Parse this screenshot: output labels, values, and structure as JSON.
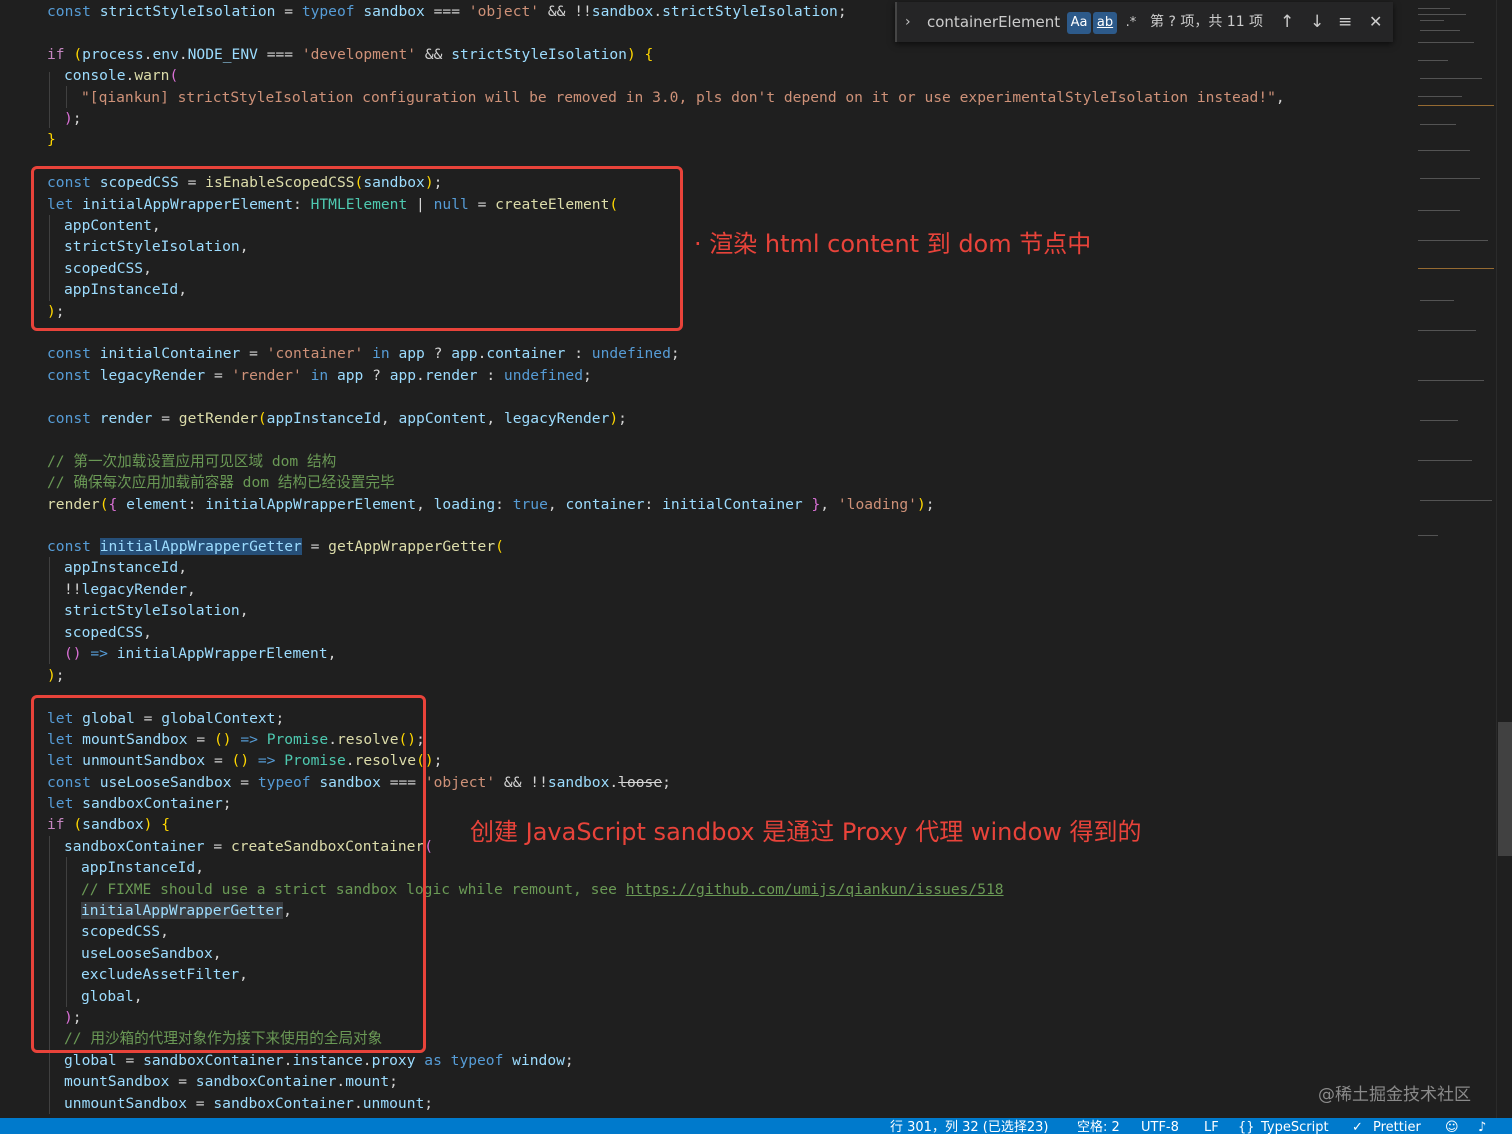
{
  "find_widget": {
    "query": "containerElement",
    "match_case_label": "Aa",
    "whole_word_label": "ab",
    "regex_label": ".*",
    "result_text": "第 ? 项，共 11 项"
  },
  "code": {
    "l1": {
      "a": "const ",
      "b": "strictStyleIsolation",
      "c": " = ",
      "d": "typeof ",
      "e": "sandbox",
      "f": " === ",
      "g": "'object'",
      "h": " && !!",
      "i": "sandbox",
      "j": ".",
      "k": "strictStyleIsolation",
      "l": ";"
    },
    "l3": {
      "a": "if ",
      "b": "(",
      "c": "process",
      "d": ".",
      "e": "env",
      "f": ".",
      "g": "NODE_ENV",
      "h": " === ",
      "i": "'development'",
      "j": " && ",
      "k": "strictStyleIsolation",
      "l": ") {"
    },
    "l4": {
      "a": "console",
      "b": ".",
      "c": "warn",
      "d": "("
    },
    "l5": {
      "a": "\"[qiankun] strictStyleIsolation configuration will be removed in 3.0, pls don't depend on it or use experimentalStyleIsolation instead!\"",
      "b": ","
    },
    "l6": {
      "a": ")",
      "b": ";"
    },
    "l7": {
      "a": "}"
    },
    "l9": {
      "a": "const ",
      "b": "scopedCSS",
      "c": " = ",
      "d": "isEnableScopedCSS",
      "e": "(",
      "f": "sandbox",
      "g": ")",
      "h": ";"
    },
    "l10": {
      "a": "let ",
      "b": "initialAppWrapperElement",
      "c": ": ",
      "d": "HTMLElement",
      "e": " | ",
      "f": "null",
      "g": " = ",
      "h": "createElement",
      "i": "("
    },
    "l11": {
      "a": "appContent",
      "b": ","
    },
    "l12": {
      "a": "strictStyleIsolation",
      "b": ","
    },
    "l13": {
      "a": "scopedCSS",
      "b": ","
    },
    "l14": {
      "a": "appInstanceId",
      "b": ","
    },
    "l15": {
      "a": ")",
      "b": ";"
    },
    "l17": {
      "a": "const ",
      "b": "initialContainer",
      "c": " = ",
      "d": "'container'",
      "e": " in ",
      "f": "app",
      "g": " ? ",
      "h": "app",
      "i": ".",
      "j": "container",
      "k": " : ",
      "l": "undefined",
      "m": ";"
    },
    "l18": {
      "a": "const ",
      "b": "legacyRender",
      "c": " = ",
      "d": "'render'",
      "e": " in ",
      "f": "app",
      "g": " ? ",
      "h": "app",
      "i": ".",
      "j": "render",
      "k": " : ",
      "l": "undefined",
      "m": ";"
    },
    "l20": {
      "a": "const ",
      "b": "render",
      "c": " = ",
      "d": "getRender",
      "e": "(",
      "f": "appInstanceId",
      "g": ", ",
      "h": "appContent",
      "i": ", ",
      "j": "legacyRender",
      "k": ")",
      "l": ";"
    },
    "l22": {
      "a": "// 第一次加载设置应用可见区域 dom 结构"
    },
    "l23": {
      "a": "// 确保每次应用加载前容器 dom 结构已经设置完毕"
    },
    "l24": {
      "a": "render",
      "b": "(",
      "c": "{ ",
      "d": "element",
      "e": ": ",
      "f": "initialAppWrapperElement",
      "g": ", ",
      "h": "loading",
      "i": ": ",
      "j": "true",
      "k": ", ",
      "l": "container",
      "m": ": ",
      "n": "initialContainer",
      "o": " }",
      "p": ", ",
      "q": "'loading'",
      "r": ")",
      "s": ";"
    },
    "l26": {
      "a": "const ",
      "b": "initialAppWrapperGetter",
      "c": " = ",
      "d": "getAppWrapperGetter",
      "e": "("
    },
    "l27": {
      "a": "appInstanceId",
      "b": ","
    },
    "l28": {
      "a": "!!",
      "b": "legacyRender",
      "c": ","
    },
    "l29": {
      "a": "strictStyleIsolation",
      "b": ","
    },
    "l30": {
      "a": "scopedCSS",
      "b": ","
    },
    "l31": {
      "a": "()",
      "b": " => ",
      "c": "initialAppWrapperElement",
      "d": ","
    },
    "l32": {
      "a": ")",
      "b": ";"
    },
    "l34": {
      "a": "let ",
      "b": "global",
      "c": " = ",
      "d": "globalContext",
      "e": ";"
    },
    "l35": {
      "a": "let ",
      "b": "mountSandbox",
      "c": " = ",
      "d": "()",
      "e": " => ",
      "f": "Promise",
      "g": ".",
      "h": "resolve",
      "i": "()",
      "j": ";"
    },
    "l36": {
      "a": "let ",
      "b": "unmountSandbox",
      "c": " = ",
      "d": "()",
      "e": " => ",
      "f": "Promise",
      "g": ".",
      "h": "resolve",
      "i": "()",
      "j": ";"
    },
    "l37": {
      "a": "const ",
      "b": "useLooseSandbox",
      "c": " = ",
      "d": "typeof ",
      "e": "sandbox",
      "f": " === ",
      "g": "'object'",
      "h": " && !!",
      "i": "sandbox",
      "j": ".",
      "k": "loose",
      "l": ";"
    },
    "l38": {
      "a": "let ",
      "b": "sandboxContainer",
      "c": ";"
    },
    "l39": {
      "a": "if ",
      "b": "(",
      "c": "sandbox",
      "d": ") {"
    },
    "l40": {
      "a": "sandboxContainer",
      "b": " = ",
      "c": "createSandboxContainer",
      "d": "("
    },
    "l41": {
      "a": "appInstanceId",
      "b": ","
    },
    "l42": {
      "a": "// FIXME should use a strict sandbox logic while remount, see ",
      "b": "https://github.com/umijs/qiankun/issues/518"
    },
    "l43": {
      "a": "initialAppWrapperGetter",
      "b": ","
    },
    "l44": {
      "a": "scopedCSS",
      "b": ","
    },
    "l45": {
      "a": "useLooseSandbox",
      "b": ","
    },
    "l46": {
      "a": "excludeAssetFilter",
      "b": ","
    },
    "l47": {
      "a": "global",
      "b": ","
    },
    "l48": {
      "a": ")",
      "b": ";"
    },
    "l49": {
      "a": "// 用沙箱的代理对象作为接下来使用的全局对象"
    },
    "l50": {
      "a": "global",
      "b": " = ",
      "c": "sandboxContainer",
      "d": ".",
      "e": "instance",
      "f": ".",
      "g": "proxy",
      "h": " as ",
      "i": "typeof ",
      "j": "window",
      "k": ";"
    },
    "l51": {
      "a": "mountSandbox",
      "b": " = ",
      "c": "sandboxContainer",
      "d": ".",
      "e": "mount",
      "f": ";"
    },
    "l52": {
      "a": "unmountSandbox",
      "b": " = ",
      "c": "sandboxContainer",
      "d": ".",
      "e": "unmount",
      "f": ";"
    }
  },
  "annotations": {
    "note1": "· 渲染 html content 到 dom 节点中",
    "note2": "创建 JavaScript sandbox 是通过 Proxy 代理 window 得到的"
  },
  "statusbar": {
    "position": "行 301，列 32 (已选择23)",
    "spaces": "空格: 2",
    "encoding": "UTF-8",
    "eol": "LF",
    "language": "TypeScript",
    "formatter": "Prettier"
  },
  "watermark": "@稀土掘金技术社区",
  "colors": {
    "editor_bg": "#1f1f1f",
    "annotation_red": "#e8433a",
    "statusbar_blue": "#007acc"
  }
}
